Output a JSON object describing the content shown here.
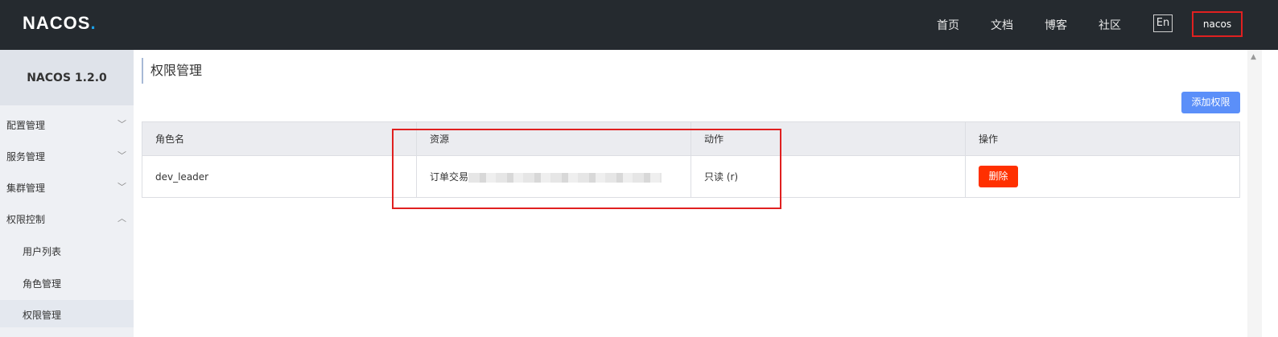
{
  "header": {
    "logo": "NACOS",
    "logo_dot": ".",
    "nav": [
      "首页",
      "文档",
      "博客",
      "社区"
    ],
    "lang": "En",
    "user": "nacos"
  },
  "sidebar": {
    "title": "NACOS 1.2.0",
    "menus": [
      {
        "label": "配置管理",
        "expanded": false
      },
      {
        "label": "服务管理",
        "expanded": false
      },
      {
        "label": "集群管理",
        "expanded": false
      },
      {
        "label": "权限控制",
        "expanded": true
      }
    ],
    "sub_items": [
      "用户列表",
      "角色管理",
      "权限管理"
    ]
  },
  "main": {
    "title": "权限管理",
    "add_button": "添加权限",
    "table": {
      "headers": [
        "角色名",
        "资源",
        "动作",
        "操作"
      ],
      "rows": [
        {
          "role": "dev_leader",
          "resource": "订单交易",
          "action": "只读 (r)",
          "op": "删除"
        }
      ]
    }
  },
  "colors": {
    "topbar": "#252a2f",
    "accent": "#5b8ff9",
    "danger": "#ff3000",
    "highlight": "#e02020"
  }
}
